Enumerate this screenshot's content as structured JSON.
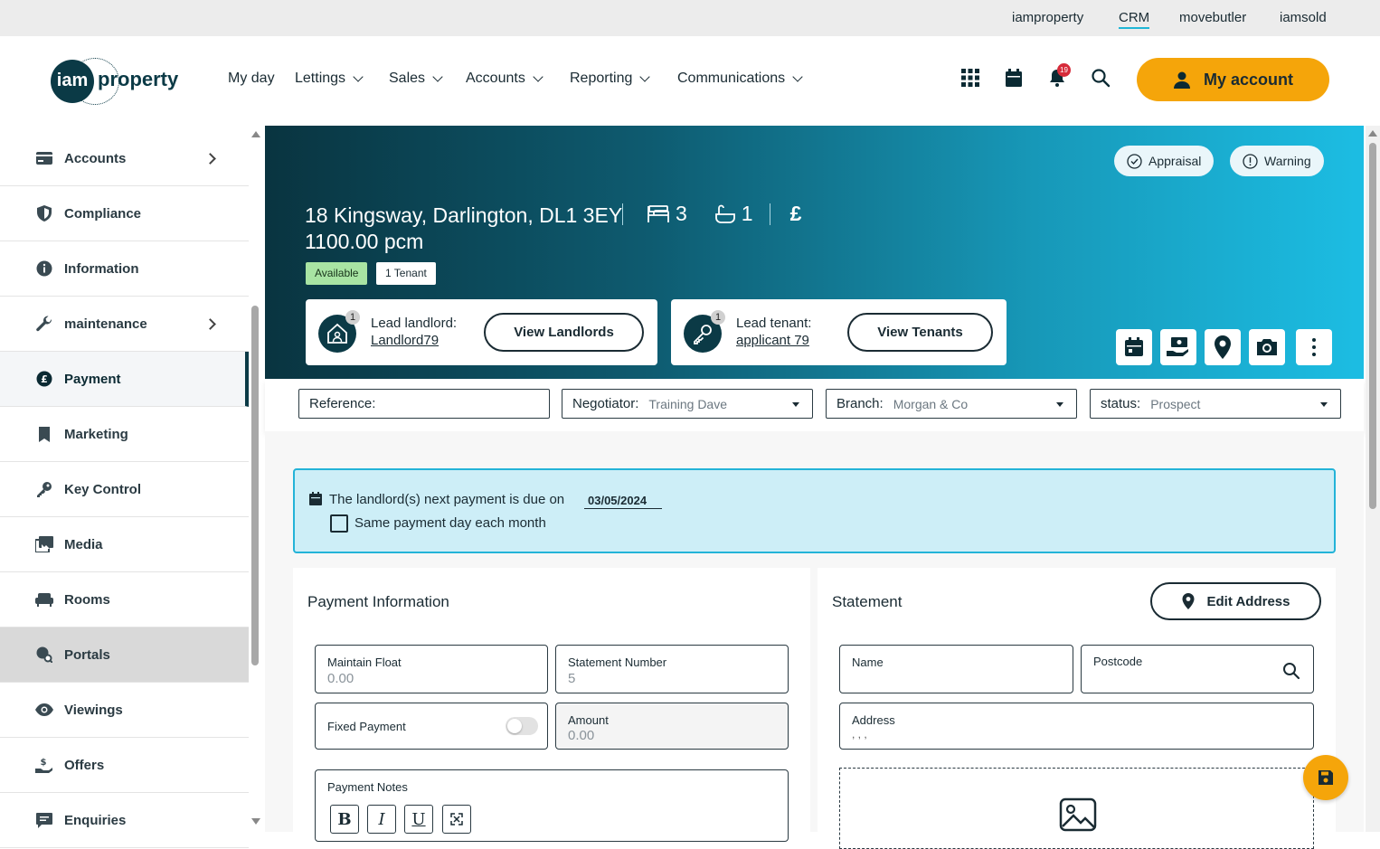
{
  "top_links": [
    "iamproperty",
    "CRM",
    "movebutler",
    "iamsold"
  ],
  "logo": {
    "circle_text": "iam",
    "text": "property"
  },
  "nav": [
    {
      "label": "My day",
      "dropdown": false
    },
    {
      "label": "Lettings",
      "dropdown": true
    },
    {
      "label": "Sales",
      "dropdown": true
    },
    {
      "label": "Accounts",
      "dropdown": true
    },
    {
      "label": "Reporting",
      "dropdown": true
    },
    {
      "label": "Communications",
      "dropdown": true
    }
  ],
  "header_icons": [
    "apps-grid-icon",
    "calendar-icon",
    "bell-icon",
    "search-icon"
  ],
  "notification_count": "19",
  "my_account_label": "My account",
  "sidebar": {
    "items": [
      {
        "label": "Accounts",
        "icon": "wallet-icon",
        "has_children": true
      },
      {
        "label": "Compliance",
        "icon": "shield-icon",
        "has_children": false
      },
      {
        "label": "Information",
        "icon": "info-icon",
        "has_children": false
      },
      {
        "label": "maintenance",
        "icon": "wrench-icon",
        "has_children": true
      },
      {
        "label": "Payment",
        "icon": "pound-icon",
        "has_children": false
      },
      {
        "label": "Marketing",
        "icon": "bookmark-icon",
        "has_children": false
      },
      {
        "label": "Key Control",
        "icon": "key-icon",
        "has_children": false
      },
      {
        "label": "Media",
        "icon": "images-icon",
        "has_children": false
      },
      {
        "label": "Rooms",
        "icon": "sofa-icon",
        "has_children": false
      },
      {
        "label": "Portals",
        "icon": "globe-search-icon",
        "has_children": false
      },
      {
        "label": "Viewings",
        "icon": "eye-icon",
        "has_children": false
      },
      {
        "label": "Offers",
        "icon": "hand-coin-icon",
        "has_children": false
      },
      {
        "label": "Enquiries",
        "icon": "message-icon",
        "has_children": false
      }
    ],
    "active": "Payment",
    "hovered": "Portals"
  },
  "hero": {
    "badges": [
      {
        "label": "Appraisal",
        "icon": "check-circle-icon"
      },
      {
        "label": "Warning",
        "icon": "alert-circle-icon"
      }
    ],
    "address": "18 Kingsway, Darlington, DL1 3EY",
    "bedrooms": "3",
    "bathrooms": "1",
    "currency": "£",
    "price": "1100.00 pcm",
    "tags": [
      "Available",
      "1 Tenant"
    ],
    "landlord": {
      "label": "Lead landlord:",
      "name": "Landlord79",
      "count": "1",
      "button": "View Landlords"
    },
    "tenant": {
      "label": "Lead tenant:",
      "name": "applicant 79",
      "count": "1",
      "button": "View Tenants"
    },
    "tools": [
      "calendar-icon",
      "hand-money-icon",
      "map-pin-icon",
      "camera-icon",
      "more-vertical-icon"
    ]
  },
  "filters": {
    "reference": {
      "label": "Reference:",
      "value": ""
    },
    "negotiator": {
      "label": "Negotiator:",
      "value": "Training Dave"
    },
    "branch": {
      "label": "Branch:",
      "value": "Morgan & Co"
    },
    "status": {
      "label": "status:",
      "value": "Prospect"
    }
  },
  "notice": {
    "text": "The landlord(s) next payment is due on",
    "date": "03/05/2024",
    "checkbox_label": "Same payment day each month",
    "checked": false
  },
  "payment_info": {
    "title": "Payment Information",
    "maintain_float": {
      "label": "Maintain Float",
      "value": "0.00"
    },
    "statement_number": {
      "label": "Statement Number",
      "value": "5"
    },
    "fixed_payment": {
      "label": "Fixed Payment",
      "on": false
    },
    "amount": {
      "label": "Amount",
      "value": "0.00"
    },
    "notes": {
      "label": "Payment Notes",
      "buttons": [
        "B",
        "I",
        "U"
      ]
    }
  },
  "statement": {
    "title": "Statement",
    "edit_address": "Edit Address",
    "name": {
      "label": "Name",
      "value": ""
    },
    "postcode": {
      "label": "Postcode",
      "value": ""
    },
    "address": {
      "label": "Address",
      "value": ", , ,"
    }
  }
}
